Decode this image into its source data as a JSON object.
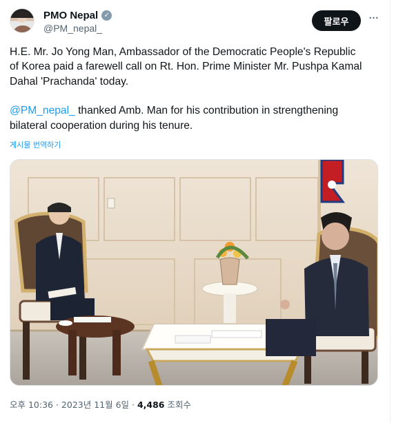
{
  "author": {
    "display_name": "PMO Nepal",
    "handle": "@PM_nepal_",
    "verified_icon": "✓"
  },
  "actions": {
    "follow_label": "팔로우",
    "more_label": "···"
  },
  "tweet": {
    "line1": "H.E. Mr. Jo Yong Man, Ambassador of the Democratic People's Republic",
    "line2": "of Korea paid a farewell call on Rt. Hon. Prime Minister Mr. Pushpa Kamal",
    "line3": "Dahal 'Prachanda' today.",
    "mention": "@PM_nepal_",
    "line4_rest": " thanked Amb. Man for his contribution in strengthening",
    "line5": "bilateral cooperation during his tenure.",
    "translate_label": "게시물 번역하기"
  },
  "meta": {
    "time": "오후 10:36",
    "separator": " · ",
    "date": "2023년 11월 6일",
    "views": "4,486",
    "views_label": " 조회수"
  },
  "colors": {
    "link": "#1d9bf0",
    "muted": "#536471",
    "text": "#0f1419",
    "button": "#0f1419"
  },
  "icons": [
    "verified-badge-icon",
    "more-icon",
    "profile-avatar"
  ]
}
